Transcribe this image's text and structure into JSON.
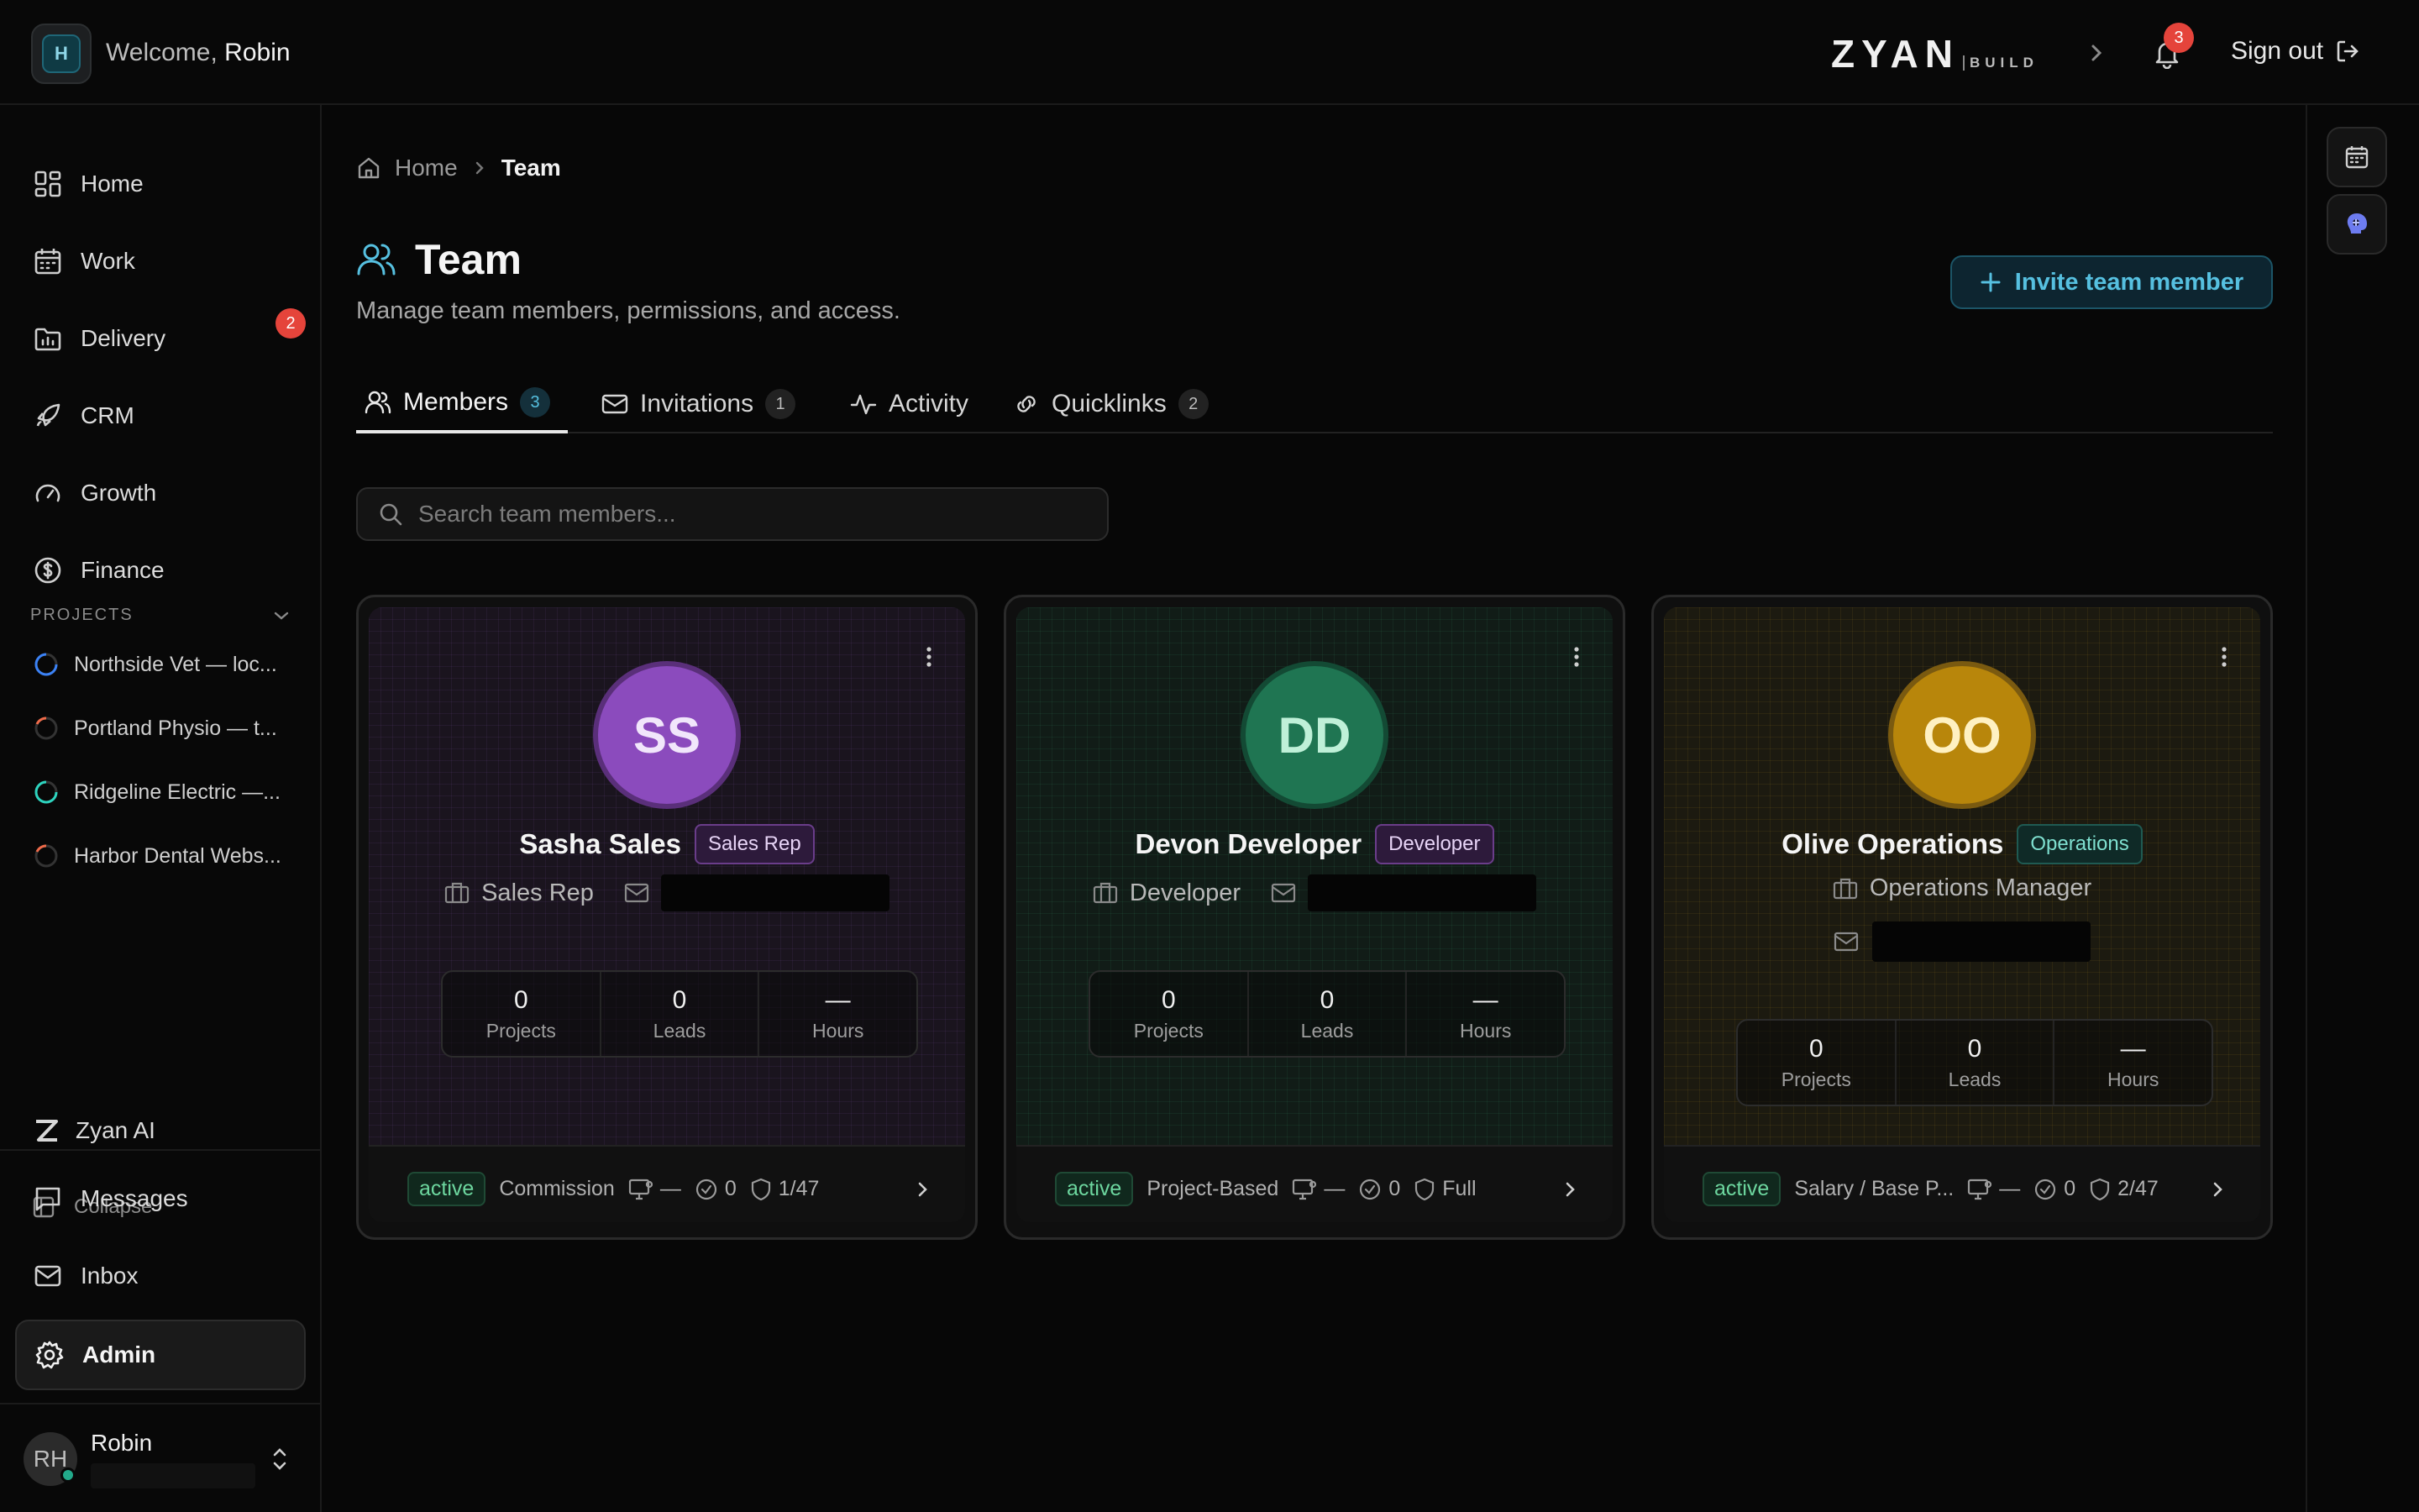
{
  "header": {
    "logo_initial": "H",
    "welcome_prefix": "Welcome,",
    "user_first_name": "Robin",
    "brand_main": "ZYAN",
    "brand_sub": "BUILD",
    "notifications_count": "3",
    "sign_out_label": "Sign out"
  },
  "sidebar": {
    "nav": [
      {
        "label": "Home",
        "icon": "dashboard-icon"
      },
      {
        "label": "Work",
        "icon": "calendar-icon"
      },
      {
        "label": "Delivery",
        "icon": "chart-folder-icon",
        "badge": "2"
      },
      {
        "label": "CRM",
        "icon": "rocket-icon"
      },
      {
        "label": "Growth",
        "icon": "gauge-icon"
      },
      {
        "label": "Finance",
        "icon": "dollar-icon"
      }
    ],
    "projects_heading": "PROJECTS",
    "projects": [
      {
        "label": "Northside Vet — loc...",
        "color": "#3b82f6"
      },
      {
        "label": "Portland Physio — t...",
        "color": "#ef6b4a"
      },
      {
        "label": "Ridgeline Electric —...",
        "color": "#2dd4bf"
      },
      {
        "label": "Harbor Dental Webs...",
        "color": "#ef6b4a"
      }
    ],
    "zyan_ai_label": "Zyan AI",
    "collapse_label": "Collapse",
    "bottom_nav": [
      {
        "label": "Messages",
        "icon": "message-icon"
      },
      {
        "label": "Inbox",
        "icon": "mail-icon"
      },
      {
        "label": "Admin",
        "icon": "gear-icon"
      }
    ],
    "user": {
      "initials": "RH",
      "name": "Robin"
    }
  },
  "breadcrumb": {
    "home": "Home",
    "current": "Team"
  },
  "page": {
    "title": "Team",
    "subtitle": "Manage team members, permissions, and access.",
    "invite_label": "Invite team member"
  },
  "tabs": [
    {
      "label": "Members",
      "count": "3",
      "icon": "users-icon"
    },
    {
      "label": "Invitations",
      "count": "1",
      "icon": "mail-icon"
    },
    {
      "label": "Activity",
      "count": "",
      "icon": "activity-icon"
    },
    {
      "label": "Quicklinks",
      "count": "2",
      "icon": "link-icon"
    }
  ],
  "search": {
    "placeholder": "Search team members..."
  },
  "members": [
    {
      "initials": "SS",
      "name": "Sasha Sales",
      "role_badge": "Sales Rep",
      "title": "Sales Rep",
      "accent": "#8b4bbd",
      "accent_text": "#f1e6fb",
      "stats": [
        {
          "value": "0",
          "label": "Projects"
        },
        {
          "value": "0",
          "label": "Leads"
        },
        {
          "value": "—",
          "label": "Hours"
        }
      ],
      "status": "active",
      "pay": "Commission",
      "device": "—",
      "tasks": "0",
      "access": "1/47"
    },
    {
      "initials": "DD",
      "name": "Devon Developer",
      "role_badge": "Developer",
      "title": "Developer",
      "accent": "#1f7552",
      "accent_text": "#bff0d8",
      "stats": [
        {
          "value": "0",
          "label": "Projects"
        },
        {
          "value": "0",
          "label": "Leads"
        },
        {
          "value": "—",
          "label": "Hours"
        }
      ],
      "status": "active",
      "pay": "Project-Based",
      "device": "—",
      "tasks": "0",
      "access": "Full"
    },
    {
      "initials": "OO",
      "name": "Olive Operations",
      "role_badge": "Operations",
      "title": "Operations Manager",
      "accent": "#b8860b",
      "accent_text": "#fff1c2",
      "stats": [
        {
          "value": "0",
          "label": "Projects"
        },
        {
          "value": "0",
          "label": "Leads"
        },
        {
          "value": "—",
          "label": "Hours"
        }
      ],
      "status": "active",
      "pay": "Salary / Base P...",
      "device": "—",
      "tasks": "0",
      "access": "2/47"
    }
  ]
}
